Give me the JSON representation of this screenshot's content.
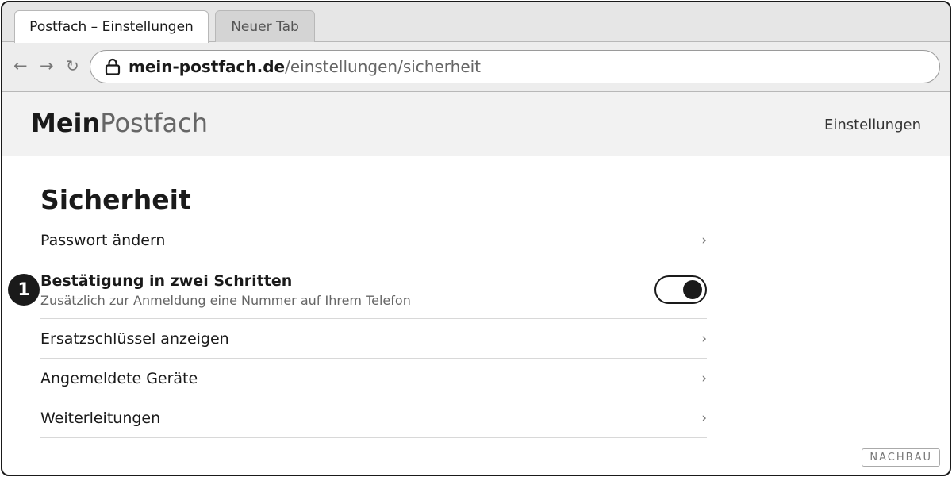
{
  "browser": {
    "tabs": [
      {
        "label": "Postfach – Einstellungen",
        "active": true
      },
      {
        "label": "Neuer Tab",
        "active": false
      }
    ],
    "nav": {
      "back": "←",
      "forward": "→",
      "reload": "↻"
    },
    "url": {
      "host": "mein-postfach.de",
      "path": "/einstellungen/sicherheit"
    }
  },
  "site": {
    "logo_bold": "Mein",
    "logo_light": "Postfach",
    "header_link": "Einstellungen"
  },
  "page": {
    "title": "Sicherheit",
    "items": [
      {
        "label": "Passwort ändern",
        "chevron": "›"
      },
      {
        "label": "Bestätigung in zwei Schritten",
        "sub": "Zusätzlich zur Anmeldung eine Nummer auf Ihrem Telefon",
        "toggle_on": true,
        "badge": "1"
      },
      {
        "label": "Ersatzschlüssel anzeigen",
        "chevron": "›"
      },
      {
        "label": "Angemeldete Geräte",
        "chevron": "›"
      },
      {
        "label": "Weiterleitungen",
        "chevron": "›"
      }
    ]
  },
  "watermark": "NACHBAU",
  "colors": {
    "ink": "#1a1a1a",
    "muted": "#666666",
    "divider": "#d8d8d8"
  }
}
